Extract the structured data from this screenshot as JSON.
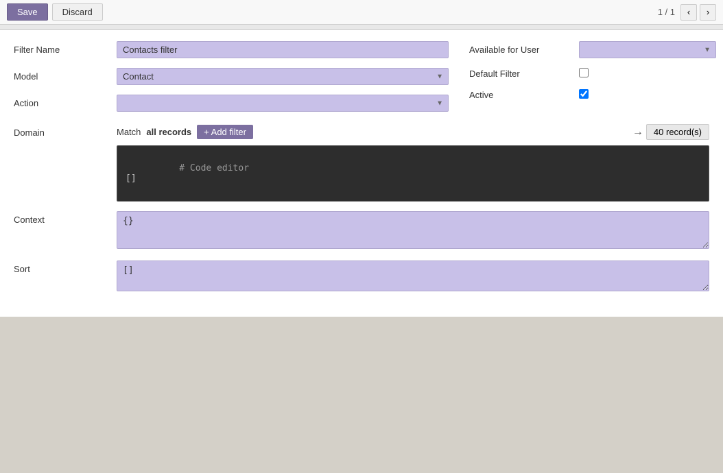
{
  "toolbar": {
    "save_label": "Save",
    "discard_label": "Discard",
    "pagination": "1 / 1"
  },
  "form": {
    "filter_name_label": "Filter Name",
    "filter_name_value": "Contacts filter",
    "model_label": "Model",
    "model_value": "Contact",
    "action_label": "Action",
    "action_value": "",
    "available_for_user_label": "Available for User",
    "available_for_user_value": "",
    "default_filter_label": "Default Filter",
    "active_label": "Active",
    "domain_label": "Domain",
    "context_label": "Context",
    "sort_label": "Sort",
    "match_text": "Match",
    "match_all_text": "all records",
    "add_filter_label": "+ Add filter",
    "records_count": "40 record(s)",
    "code_editor_comment": "# Code editor",
    "code_editor_value": "[]",
    "context_value": "{}",
    "sort_value": "[]"
  },
  "icons": {
    "chevron_left": "‹",
    "chevron_right": "›",
    "arrow_right": "→",
    "plus": "+"
  }
}
